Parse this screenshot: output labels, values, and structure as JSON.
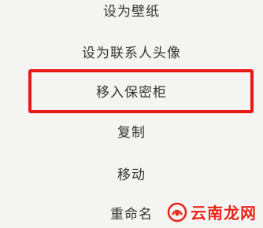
{
  "menu": {
    "items": [
      {
        "label": "设为壁纸"
      },
      {
        "label": "设为联系人头像"
      },
      {
        "label": "移入保密柜"
      },
      {
        "label": "复制"
      },
      {
        "label": "移动"
      },
      {
        "label": "重命名"
      }
    ],
    "highlighted_item": "移入保密柜",
    "highlight_color": "#e81919"
  },
  "watermark": {
    "text": "云南龙网",
    "icon": "logo-icon",
    "color": "#e8231b"
  }
}
